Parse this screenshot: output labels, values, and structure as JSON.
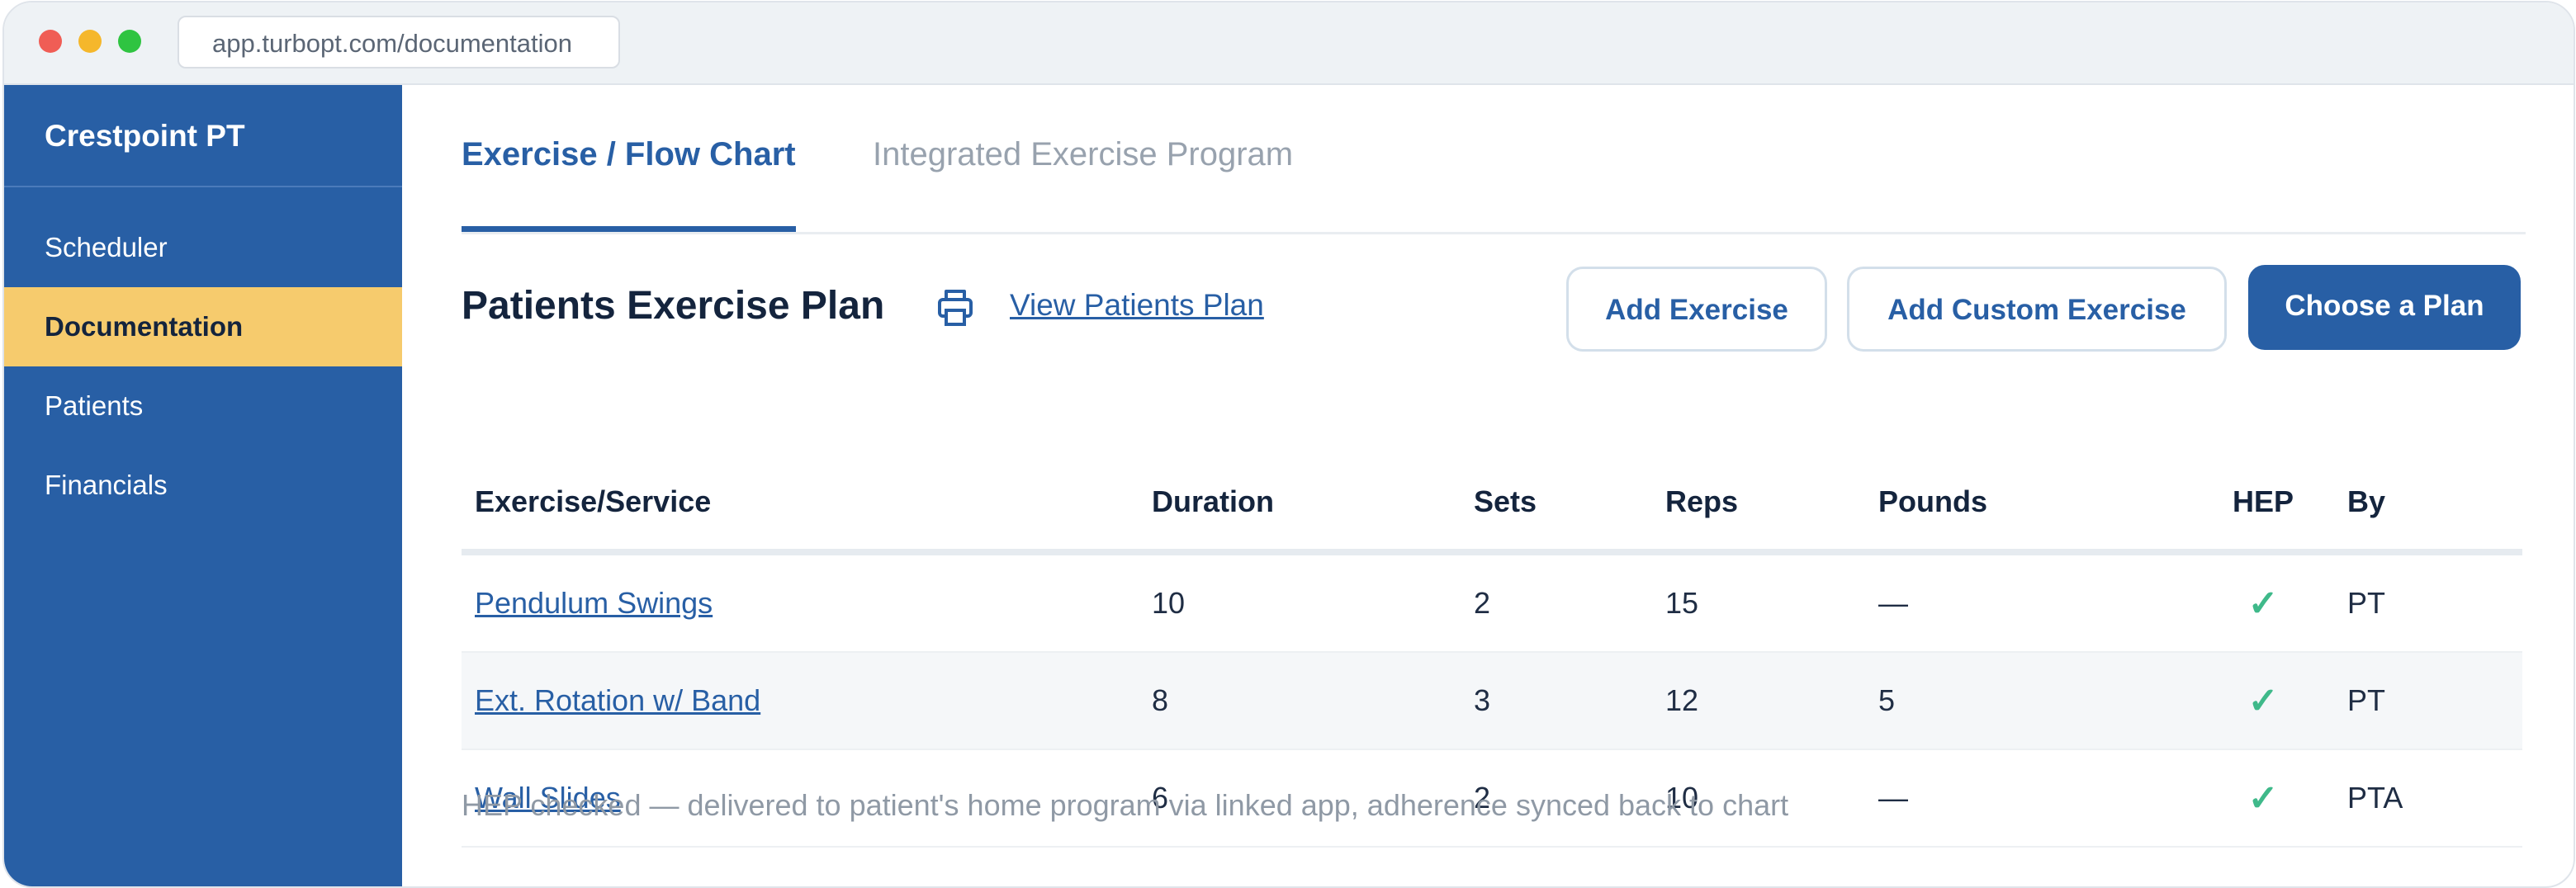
{
  "browser": {
    "url": "app.turbopt.com/documentation"
  },
  "sidebar": {
    "brand": "Crestpoint PT",
    "items": [
      {
        "label": "Scheduler",
        "active": false
      },
      {
        "label": "Documentation",
        "active": true
      },
      {
        "label": "Patients",
        "active": false
      },
      {
        "label": "Financials",
        "active": false
      }
    ]
  },
  "tabs": [
    {
      "label": "Exercise / Flow Chart",
      "active": true
    },
    {
      "label": "Integrated Exercise Program",
      "active": false
    }
  ],
  "plan": {
    "title": "Patients Exercise Plan",
    "print_icon": "printer-icon",
    "view_link": "View Patients Plan",
    "buttons": {
      "add_exercise": "Add Exercise",
      "add_custom": "Add Custom Exercise",
      "choose_plan": "Choose a Plan"
    }
  },
  "table": {
    "headers": [
      "Exercise/Service",
      "Duration",
      "Sets",
      "Reps",
      "Pounds",
      "HEP",
      "By"
    ],
    "rows": [
      {
        "exercise": "Pendulum Swings",
        "duration": "10",
        "sets": "2",
        "reps": "15",
        "pounds": "—",
        "hep": true,
        "hep_mark": "✓",
        "by": "PT"
      },
      {
        "exercise": "Ext. Rotation w/ Band",
        "duration": "8",
        "sets": "3",
        "reps": "12",
        "pounds": "5",
        "hep": true,
        "hep_mark": "✓",
        "by": "PT"
      },
      {
        "exercise": "Wall Slides",
        "duration": "6",
        "sets": "2",
        "reps": "10",
        "pounds": "—",
        "hep": true,
        "hep_mark": "✓",
        "by": "PTA"
      }
    ]
  },
  "footnote": "HEP checked — delivered to patient's home program via linked app, adherence synced back to chart",
  "colors": {
    "primary": "#285fa5",
    "active_nav": "#f6cb6d",
    "check": "#3fb98a"
  }
}
